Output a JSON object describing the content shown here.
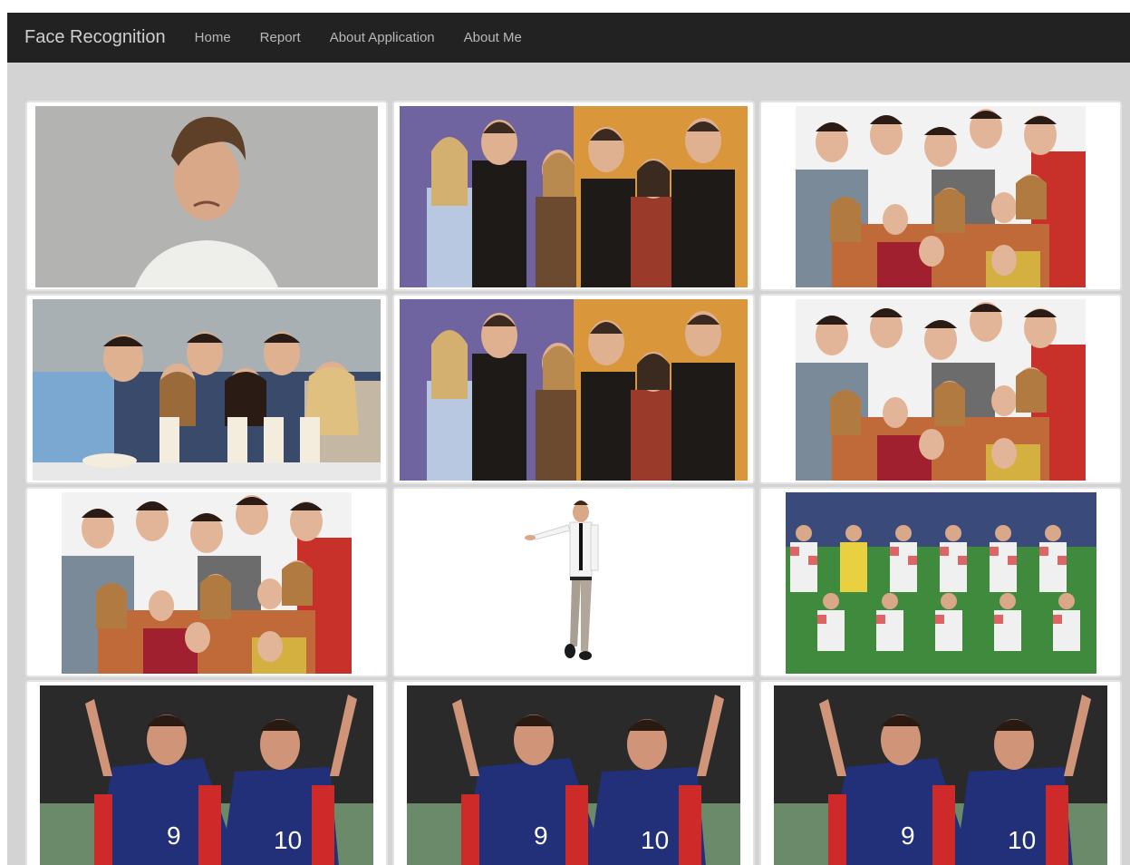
{
  "navbar": {
    "brand": "Face Recognition",
    "links": [
      "Home",
      "Report",
      "About Application",
      "About Me"
    ]
  },
  "gallery": {
    "images": [
      {
        "icon": "sad-man-photo"
      },
      {
        "icon": "friends-cast-photo"
      },
      {
        "icon": "family-group-photo"
      },
      {
        "icon": "friends-milkshake-photo"
      },
      {
        "icon": "friends-cast-photo"
      },
      {
        "icon": "family-group-photo"
      },
      {
        "icon": "family-group-photo"
      },
      {
        "icon": "businessman-pointing-photo"
      },
      {
        "icon": "football-team-photo"
      },
      {
        "icon": "football-celebration-photo"
      },
      {
        "icon": "football-celebration-photo"
      },
      {
        "icon": "football-celebration-photo"
      }
    ]
  }
}
